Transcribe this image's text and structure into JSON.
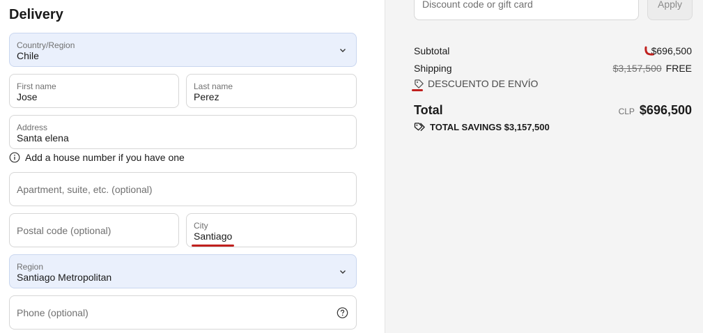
{
  "delivery": {
    "heading": "Delivery",
    "country": {
      "label": "Country/Region",
      "value": "Chile"
    },
    "first_name": {
      "label": "First name",
      "value": "Jose"
    },
    "last_name": {
      "label": "Last name",
      "value": "Perez"
    },
    "address": {
      "label": "Address",
      "value": "Santa elena"
    },
    "address_hint": "Add a house number if you have one",
    "apartment": {
      "placeholder": "Apartment, suite, etc. (optional)"
    },
    "postal_code": {
      "placeholder": "Postal code (optional)"
    },
    "city": {
      "label": "City",
      "value": "Santiago"
    },
    "region": {
      "label": "Region",
      "value": "Santiago Metropolitan"
    },
    "phone": {
      "placeholder": "Phone (optional)"
    }
  },
  "summary": {
    "discount_placeholder": "Discount code or gift card",
    "apply_label": "Apply",
    "subtotal_label": "Subtotal",
    "subtotal_value": "$696,500",
    "shipping_label": "Shipping",
    "shipping_original": "$3,157,500",
    "shipping_value": "FREE",
    "shipping_discount": "DESCUENTO DE ENVÍO",
    "total_label": "Total",
    "total_currency": "CLP",
    "total_value": "$696,500",
    "savings_label": "TOTAL SAVINGS $3,157,500"
  },
  "colors": {
    "accent_select_bg": "#eaf0fc",
    "annotation_red": "#c0201e",
    "summary_bg": "#f4f4f4"
  }
}
